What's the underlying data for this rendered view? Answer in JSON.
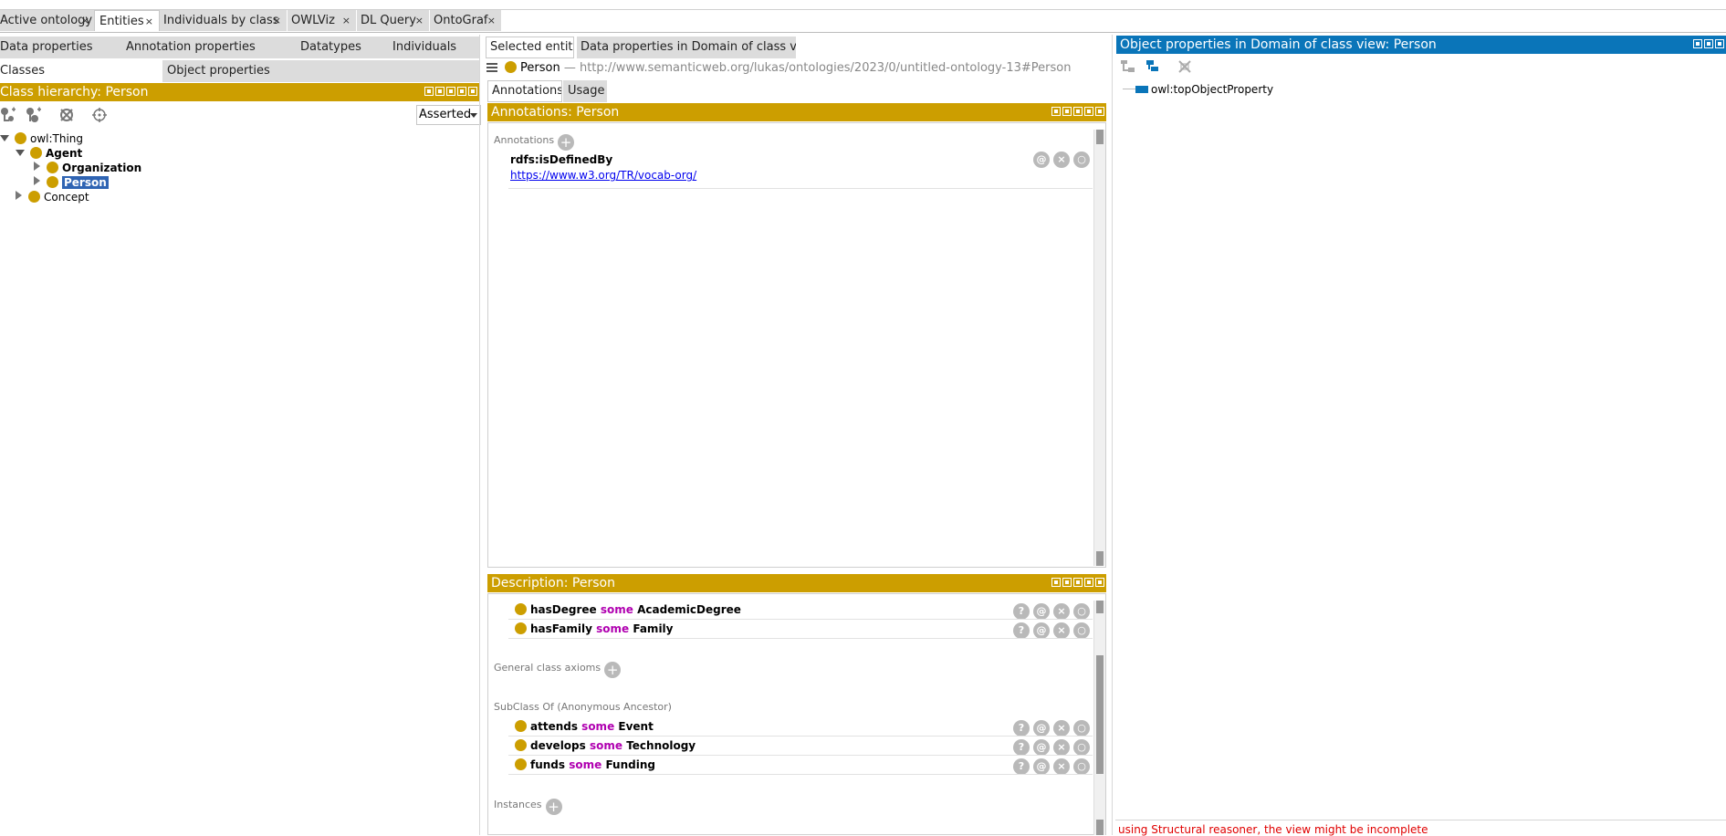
{
  "main_tabs": [
    {
      "label": "Active ontology",
      "close": "×"
    },
    {
      "label": "Entities",
      "close": "×"
    },
    {
      "label": "Individuals by class",
      "close": "×"
    },
    {
      "label": "OWLViz",
      "close": "×"
    },
    {
      "label": "DL Query",
      "close": "×"
    },
    {
      "label": "OntoGraf",
      "close": "×"
    }
  ],
  "left_subtabs": {
    "row1": [
      "Data properties",
      "Annotation properties",
      "Datatypes",
      "Individuals"
    ],
    "row2": [
      "Classes",
      "Object properties"
    ]
  },
  "class_hierarchy": {
    "title": "Class hierarchy: Person",
    "mode": "Asserted",
    "tree": [
      "owl:Thing",
      "Agent",
      "Organization",
      "Person",
      "Concept"
    ]
  },
  "middle_tabs": [
    "Selected entity",
    "Data properties in Domain of class view"
  ],
  "entity_line": {
    "name": "Person",
    "iri": "— http://www.semanticweb.org/lukas/ontologies/2023/0/untitled-ontology-13#Person"
  },
  "inner_tabs": [
    "Annotations",
    "Usage"
  ],
  "annotations_panel": {
    "title": "Annotations: Person",
    "section_label": "Annotations",
    "property": "rdfs:isDefinedBy",
    "value": "https://www.w3.org/TR/vocab-org/"
  },
  "description_panel": {
    "title": "Description: Person",
    "top_rows": [
      {
        "prop": "hasDegree",
        "kw": "some",
        "cls": "AcademicDegree"
      },
      {
        "prop": "hasFamily",
        "kw": "some",
        "cls": "Family"
      }
    ],
    "general_axioms_label": "General class axioms",
    "anon_label": "SubClass Of (Anonymous Ancestor)",
    "anon_rows": [
      {
        "prop": "attends",
        "kw": "some",
        "cls": "Event"
      },
      {
        "prop": "develops",
        "kw": "some",
        "cls": "Technology"
      },
      {
        "prop": "funds",
        "kw": "some",
        "cls": "Funding"
      }
    ],
    "instances_label": "Instances"
  },
  "object_props_panel": {
    "title": "Object properties in Domain of class view: Person",
    "root": "owl:topObjectProperty",
    "status": "using Structural reasoner, the view might be incomplete"
  },
  "row_button_glyphs": {
    "help": "?",
    "at": "@",
    "delete": "×",
    "edit": "○"
  },
  "colors": {
    "class_gold": "#cc9e00",
    "object_prop_blue": "#0a75b9",
    "keyword_purple": "#b000b0",
    "status_red": "#e00000",
    "link_blue": "#0000ee"
  }
}
